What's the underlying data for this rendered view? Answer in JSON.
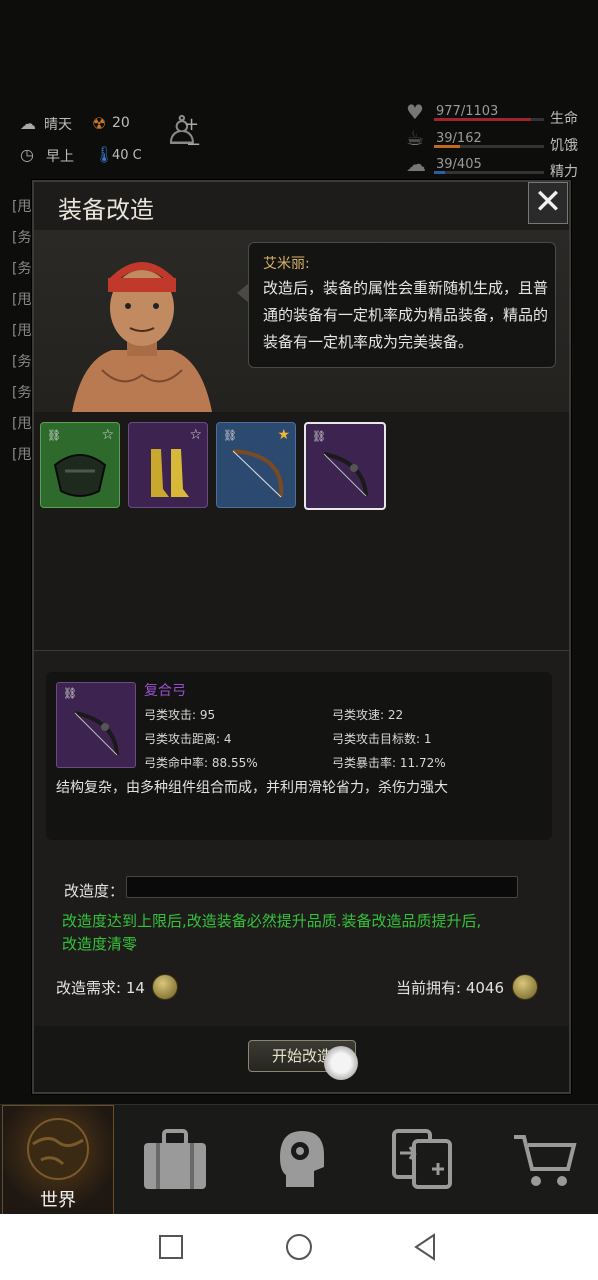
{
  "hud": {
    "weather": "晴天",
    "radiation": "20",
    "time_of_day": "早上",
    "temperature": "40 C",
    "life_value": "977/1103",
    "life_label": "生命",
    "life_fraction": 0.886,
    "hunger_value": "39/162",
    "hunger_label": "饥饿",
    "hunger_fraction": 0.24,
    "energy_value": "39/405",
    "energy_label": "精力",
    "energy_fraction": 0.096
  },
  "background_log": [
    "[甩",
    "[务",
    "[务",
    "[甩",
    "[甩",
    "[务",
    "[务",
    "[甩",
    "[甩"
  ],
  "dialog": {
    "title": "装备改造",
    "close_label": "✕",
    "speaker": "艾米丽:",
    "speech": "改造后，装备的属性会重新随机生成，且普通的装备有一定机率成为精品装备，精品的装备有一定机率成为完美装备。"
  },
  "slots": [
    {
      "name": "green-helmet",
      "rarity_color": "#2f6b2c",
      "star": "☆"
    },
    {
      "name": "yellow-boots",
      "rarity_color": "#3f2a4f",
      "star": "☆"
    },
    {
      "name": "blue-bow",
      "rarity_color": "#2c4a70",
      "star": "★"
    },
    {
      "name": "compound-bow",
      "rarity_color": "#3d2450",
      "star": ""
    }
  ],
  "selected_item": {
    "name": "复合弓",
    "stats": [
      "弓类攻击: 95",
      "弓类攻速: 22",
      "弓类攻击距离: 4",
      "弓类攻击目标数: 1",
      "弓类命中率: 88.55%",
      "弓类暴击率: 11.72%"
    ],
    "description": "结构复杂，由多种组件组合而成，并利用滑轮省力，杀伤力强大"
  },
  "upgrade": {
    "progress_label": "改造度：",
    "progress_fraction": 0,
    "notice": "改造度达到上限后,改造装备必然提升品质.装备改造品质提升后,改造度清零",
    "requirement_label": "改造需求: 14",
    "owned_label": "当前拥有: 4046",
    "start_button": "开始改造"
  },
  "nav": {
    "world_label": "世界"
  },
  "colors": {
    "accent_gold": "#d8b46a",
    "notice_green": "#35c23a",
    "epic_purple": "#9a4fd0"
  }
}
